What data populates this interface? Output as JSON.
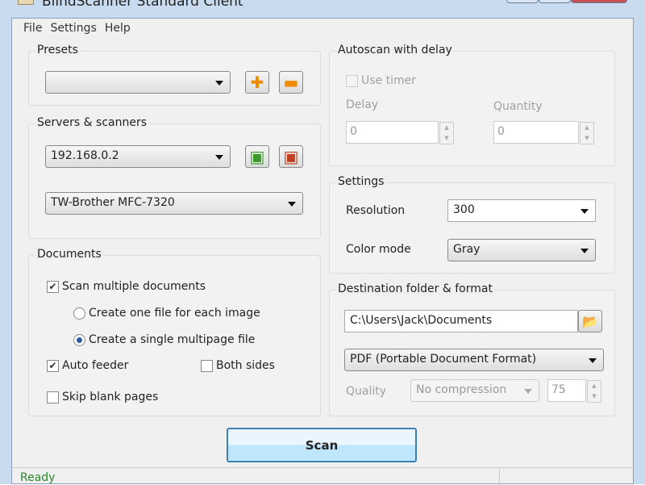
{
  "window": {
    "title": "BlindScanner Standard Client"
  },
  "menu": [
    "File",
    "Settings",
    "Help"
  ],
  "presets": {
    "label": "Presets",
    "value": ""
  },
  "servers": {
    "label": "Servers & scanners",
    "server": "192.168.0.2",
    "scanner": "TW-Brother MFC-7320"
  },
  "documents": {
    "label": "Documents",
    "scan_multiple": "Scan multiple documents",
    "one_file": "Create one file for each image",
    "single_file": "Create a single multipage file",
    "auto_feeder": "Auto feeder",
    "both_sides": "Both sides",
    "skip_blank": "Skip blank pages"
  },
  "autoscan": {
    "label": "Autoscan with delay",
    "use_timer": "Use timer",
    "delay_label": "Delay",
    "delay": "0",
    "quantity_label": "Quantity",
    "quantity": "0"
  },
  "settings": {
    "label": "Settings",
    "resolution_label": "Resolution",
    "resolution": "300",
    "color_label": "Color mode",
    "color": "Gray"
  },
  "destination": {
    "label": "Destination folder & format",
    "folder": "C:\\Users\\Jack\\Documents",
    "format": "PDF (Portable Document Format)",
    "quality_label": "Quality",
    "compression": "No compression",
    "quality": "75"
  },
  "scan_label": "Scan",
  "status": "Ready"
}
